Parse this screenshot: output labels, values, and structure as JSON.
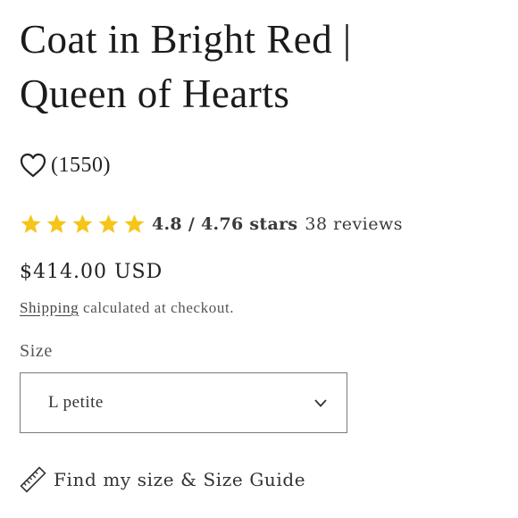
{
  "product": {
    "title_line1": "Coat in Bright Red |",
    "title_line2": "Queen of Hearts",
    "favorites_count": "(1550)",
    "rating": {
      "stars": 5,
      "text": "4.8 / 4.76 stars",
      "reviews": "38 reviews",
      "star_color": "#f5c518"
    },
    "price": "$414.00 USD",
    "shipping": {
      "link_label": "Shipping",
      "note": " calculated at checkout."
    },
    "size": {
      "label": "Size",
      "selected": "L petite"
    },
    "size_guide": {
      "label": "Find my size & Size Guide"
    }
  },
  "icons": {
    "favorite": "heart-icon",
    "rating": "star-icon",
    "dropdown": "chevron-down-icon",
    "size_guide": "ruler-icon"
  }
}
